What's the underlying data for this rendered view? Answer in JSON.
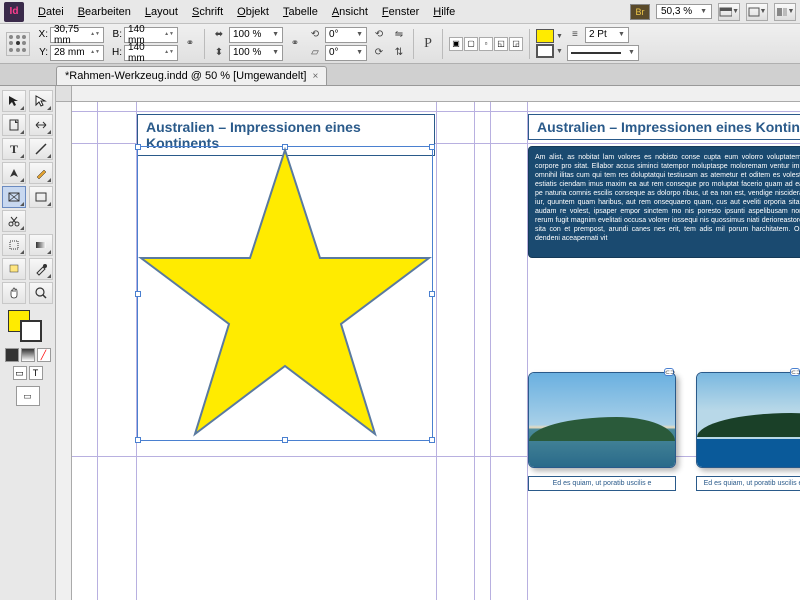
{
  "app_badge": "Id",
  "menu": [
    "Datei",
    "Bearbeiten",
    "Layout",
    "Schrift",
    "Objekt",
    "Tabelle",
    "Ansicht",
    "Fenster",
    "Hilfe"
  ],
  "bridge": "Br",
  "zoom": "50,3 %",
  "ctrl": {
    "x": "30,75 mm",
    "y": "28 mm",
    "b": "140 mm",
    "h": "140 mm",
    "sx": "100 %",
    "sy": "100 %",
    "rot": "0°",
    "shear": "0°",
    "stroke_w": "2 Pt"
  },
  "tab": "*Rahmen-Werkzeug.indd @ 50 % [Umgewandelt]",
  "page": {
    "title": "Australien – Impressionen eines Kontinents",
    "lorem": "Am alist, as nobitat lam volores es nobisto conse cupta eum volorro voluptatem, corpore pro sitat. Ellabor accus siminci tatempor moluptaspe moloremam ventur imi, omnihil ilitas cum qui tem res doluptatqui testiusam as atemetur et oditem es volest, estiatis ciendam imus maxim ea aut rem conseque pro moluptat facerio quam ad ea pe naturia comnis escilis conseque as dolorpo ribus, ut ea non est, vendige niscidera iur, quuntem quam haribus, aut rem onsequaero quam, cus aut eveliti orporia sitas audam re volest, ipsaper empor sinctem mo nis poresto ipsunti aspelibusam non rerum fugit magnim evelitati occusa volorer iossequi nis quossimus niati derioreastore sita con et prempost, arundi canes nes erit, tem adis mil porum harchitatem. Os dendeni aceapernati vit",
    "caption": "Ed es quiam, ut poratib uscilis e"
  }
}
